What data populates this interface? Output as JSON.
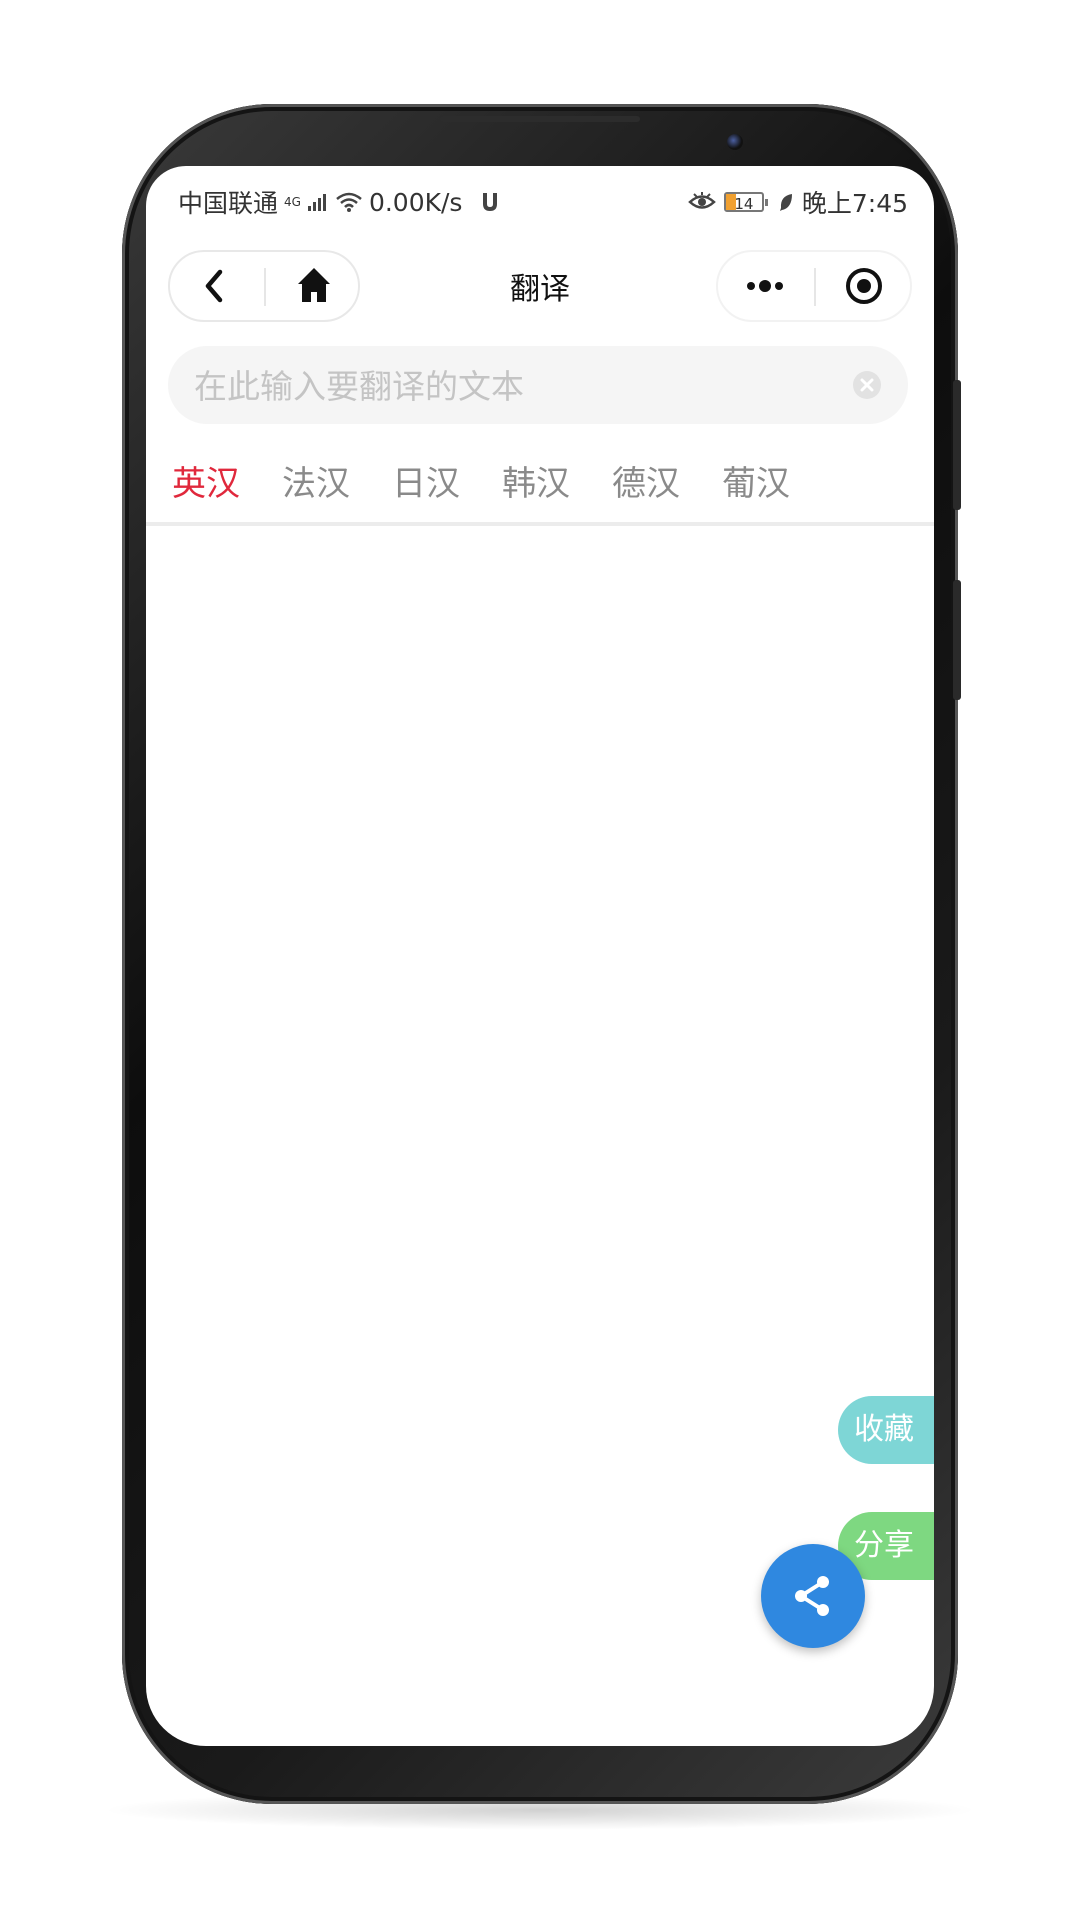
{
  "status_bar": {
    "carrier": "中国联通",
    "network": "4G",
    "speed": "0.00K/s",
    "battery": "14",
    "time": "晚上7:45"
  },
  "nav": {
    "title": "翻译"
  },
  "search": {
    "value": "",
    "placeholder": "在此输入要翻译的文本"
  },
  "tabs": [
    {
      "label": "英汉",
      "active": true
    },
    {
      "label": "法汉",
      "active": false
    },
    {
      "label": "日汉",
      "active": false
    },
    {
      "label": "韩汉",
      "active": false
    },
    {
      "label": "德汉",
      "active": false
    },
    {
      "label": "葡汉",
      "active": false
    }
  ],
  "fab": {
    "collect_label": "收藏",
    "share_label": "分享"
  },
  "colors": {
    "accent_tab": "#e0283c",
    "collect_bg": "#7ed6d6",
    "share_label_bg": "#7ed881",
    "share_fab_bg": "#2f88e0"
  }
}
